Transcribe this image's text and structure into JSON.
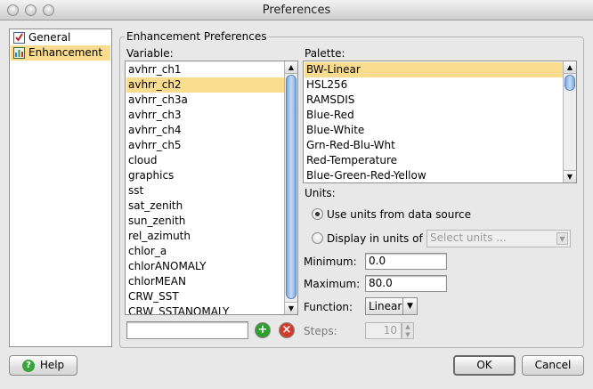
{
  "window": {
    "title": "Preferences"
  },
  "nav": {
    "items": [
      {
        "label": "General",
        "icon": "checklist-icon"
      },
      {
        "label": "Enhancement",
        "icon": "bar-chart-icon"
      }
    ],
    "selected_index": 1
  },
  "group": {
    "title": "Enhancement Preferences"
  },
  "variable": {
    "label": "Variable:",
    "items": [
      "avhrr_ch1",
      "avhrr_ch2",
      "avhrr_ch3a",
      "avhrr_ch3",
      "avhrr_ch4",
      "avhrr_ch5",
      "cloud",
      "graphics",
      "sst",
      "sat_zenith",
      "sun_zenith",
      "rel_azimuth",
      "chlor_a",
      "chlorANOMALY",
      "chlorMEAN",
      "CRW_SST",
      "CRW_SSTANOMALY"
    ],
    "selected_index": 1,
    "input_value": ""
  },
  "palette": {
    "label": "Palette:",
    "items": [
      "BW-Linear",
      "HSL256",
      "RAMSDIS",
      "Blue-Red",
      "Blue-White",
      "Grn-Red-Blu-Wht",
      "Red-Temperature",
      "Blue-Green-Red-Yellow"
    ],
    "selected_index": 0
  },
  "units": {
    "label": "Units:",
    "option_source": "Use units from data source",
    "option_display": "Display in units of",
    "selected": "source",
    "select_placeholder": "Select units ..."
  },
  "minimum": {
    "label": "Minimum:",
    "value": "0.0"
  },
  "maximum": {
    "label": "Maximum:",
    "value": "80.0"
  },
  "function": {
    "label": "Function:",
    "value": "Linear"
  },
  "steps": {
    "label": "Steps:",
    "value": "10"
  },
  "buttons": {
    "help": "Help",
    "ok": "OK",
    "cancel": "Cancel"
  },
  "colors": {
    "selection": "#f9dc8e",
    "add_green": "#2e9e2e",
    "remove_red": "#d23a2a"
  }
}
